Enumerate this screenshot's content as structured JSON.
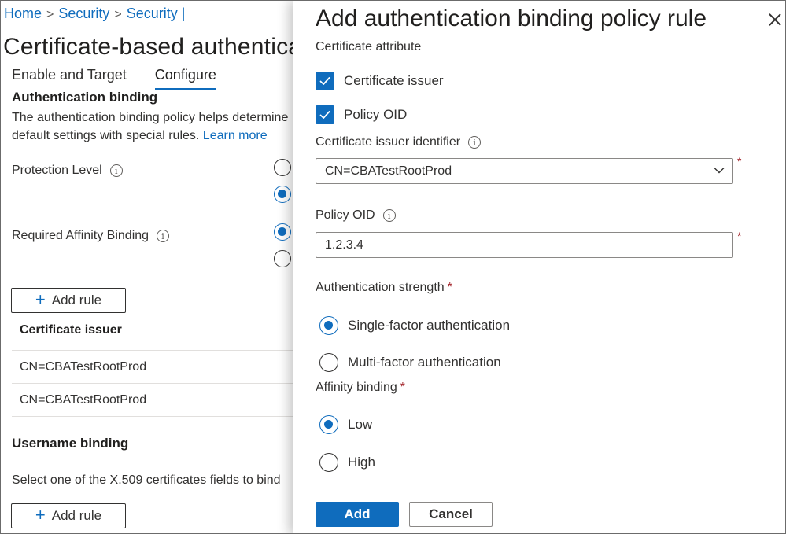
{
  "breadcrumb": {
    "home": "Home",
    "item1": "Security",
    "item2": "Security |"
  },
  "page": {
    "title": "Certificate-based authentication"
  },
  "tabs": [
    {
      "label": "Enable and Target"
    },
    {
      "label": "Configure"
    }
  ],
  "auth_binding": {
    "heading": "Authentication binding",
    "desc_line1": "The authentication binding policy helps determine",
    "desc_line2": "default settings with special rules.",
    "learn_more": "Learn more",
    "protection_level_label": "Protection Level",
    "affinity_label": "Required Affinity Binding",
    "add_rule": "Add rule",
    "table_header": "Certificate issuer",
    "rows": [
      "CN=CBATestRootProd",
      "CN=CBATestRootProd"
    ]
  },
  "username_binding": {
    "heading": "Username binding",
    "desc": "Select one of the X.509 certificates fields to bind",
    "add_rule": "Add rule"
  },
  "panel": {
    "title": "Add authentication binding policy rule",
    "cert_attribute_label": "Certificate attribute",
    "checkbox_issuer": "Certificate issuer",
    "checkbox_policy_oid": "Policy OID",
    "issuer_identifier_label": "Certificate issuer identifier",
    "issuer_identifier_value": "CN=CBATestRootProd",
    "policy_oid_label": "Policy OID",
    "policy_oid_value": "1.2.3.4",
    "auth_strength_label": "Authentication strength",
    "single_factor": "Single-factor authentication",
    "multi_factor": "Multi-factor authentication",
    "affinity_label": "Affinity binding",
    "low": "Low",
    "high": "High",
    "required_mark": "*",
    "add_button": "Add",
    "cancel_button": "Cancel"
  },
  "icons": {
    "info": "i",
    "close": "close-icon",
    "chevron": "chevron-down-icon",
    "plus": "+"
  },
  "colors": {
    "accent": "#0f6cbd",
    "required": "#a4262c"
  }
}
